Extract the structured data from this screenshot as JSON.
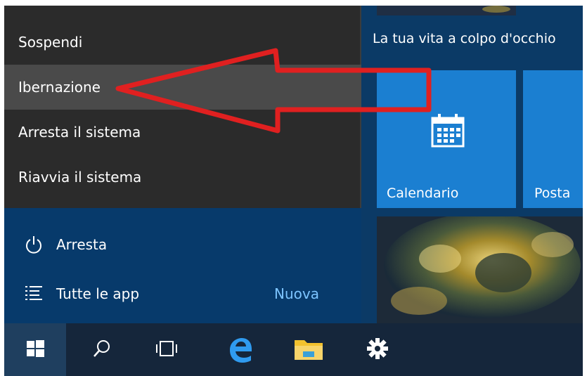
{
  "power_menu": {
    "items": [
      {
        "label": "Sospendi"
      },
      {
        "label": "Ibernazione"
      },
      {
        "label": "Arresta il sistema"
      },
      {
        "label": "Riavvia il sistema"
      }
    ],
    "highlighted_index": 1
  },
  "start_left": {
    "power_label": "Arresta",
    "all_apps_label": "Tutte le app",
    "new_badge": "Nuova",
    "icons": {
      "power": "power-icon",
      "all_apps": "list-icon"
    }
  },
  "tiles": {
    "group_title": "La tua vita a colpo d'occhio",
    "calendar_label": "Calendario",
    "mail_label": "Posta",
    "icons": {
      "calendar": "calendar-icon",
      "photo": "photos-tile-image"
    },
    "accent_color": "#1b7fd1"
  },
  "taskbar": {
    "icons": [
      "windows-start-icon",
      "search-icon",
      "task-view-icon",
      "edge-icon",
      "file-explorer-icon",
      "settings-gear-icon"
    ]
  },
  "annotation": {
    "type": "red-arrow",
    "points_to": "Ibernazione",
    "color": "#e02020"
  }
}
